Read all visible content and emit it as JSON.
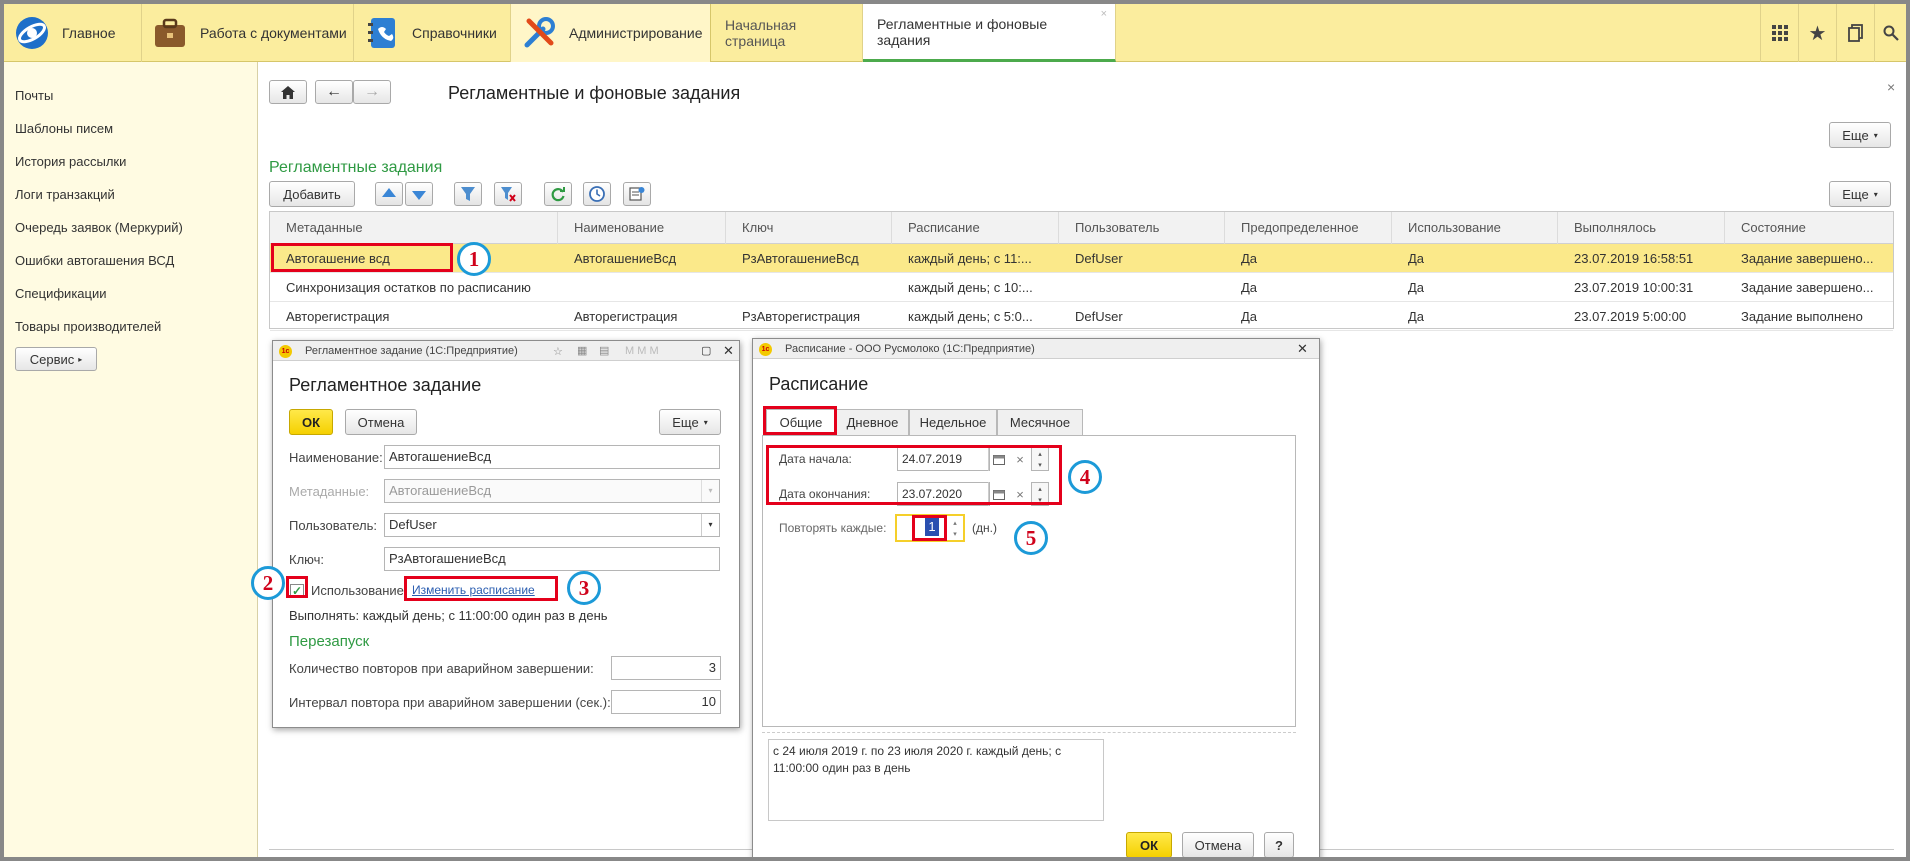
{
  "topbar": {
    "sections": [
      {
        "label": "Главное",
        "icon": "main-logo-icon"
      },
      {
        "label": "Работа с документами",
        "icon": "briefcase-icon"
      },
      {
        "label": "Справочники",
        "icon": "address-book-icon"
      },
      {
        "label": "Администрирование",
        "icon": "tools-icon"
      }
    ],
    "open_tabs": [
      "Начальная страница",
      "Регламентные и фоновые задания"
    ],
    "right_icons": [
      "apps-grid-icon",
      "star-icon",
      "history-icon",
      "search-icon"
    ]
  },
  "sidebar": {
    "items": [
      "Почты",
      "Шаблоны писем",
      "История рассылки",
      "Логи транзакций",
      "Очередь заявок (Меркурий)",
      "Ошибки автогашения ВСД",
      "Спецификации",
      "Товары производителей"
    ],
    "service_button": "Сервис"
  },
  "page": {
    "title": "Регламентные и фоновые задания",
    "more_label": "Еще",
    "section_title": "Регламентные задания",
    "add_label": "Добавить",
    "more_label2": "Еще"
  },
  "grid": {
    "columns": [
      "Метаданные",
      "Наименование",
      "Ключ",
      "Расписание",
      "Пользователь",
      "Предопределенное",
      "Использование",
      "Выполнялось",
      "Состояние"
    ],
    "rows": [
      [
        "Автогашение всд",
        "АвтогашениеВсд",
        "РзАвтогашениеВсд",
        "каждый  день; с 11:...",
        "DefUser",
        "Да",
        "Да",
        "23.07.2019 16:58:51",
        "Задание завершено..."
      ],
      [
        "Синхронизация остатков по расписанию",
        "",
        "",
        "каждый  день; с 10:...",
        "",
        "Да",
        "Да",
        "23.07.2019 10:00:31",
        "Задание завершено..."
      ],
      [
        "Авторегистрация",
        "Авторегистрация",
        "РзАвторегистрация",
        "каждый  день; с 5:0...",
        "DefUser",
        "Да",
        "Да",
        "23.07.2019 5:00:00",
        "Задание выполнено"
      ]
    ]
  },
  "job_window": {
    "title": "Регламентное задание  (1С:Предприятие)",
    "heading": "Регламентное задание",
    "ok": "ОК",
    "cancel": "Отмена",
    "more": "Еще",
    "name_label": "Наименование:",
    "name_value": "АвтогашениеВсд",
    "meta_label": "Метаданные:",
    "meta_value": "АвтогашениеВсд",
    "user_label": "Пользователь:",
    "user_value": "DefUser",
    "key_label": "Ключ:",
    "key_value": "РзАвтогашениеВсд",
    "use_label": "Использование",
    "change_link": "Изменить расписание",
    "run_text": "Выполнять: каждый  день; с 11:00:00 один раз в день",
    "restart_title": "Перезапуск",
    "retries_label": "Количество повторов при аварийном завершении:",
    "retries_value": "3",
    "interval_label": "Интервал повтора при аварийном завершении (сек.):",
    "interval_value": "10"
  },
  "schedule_window": {
    "title": "Расписание - ООО Русмолоко  (1С:Предприятие)",
    "heading": "Расписание",
    "tabs": [
      "Общие",
      "Дневное",
      "Недельное",
      "Месячное"
    ],
    "start_label": "Дата начала:",
    "start_value": "24.07.2019",
    "end_label": "Дата окончания:",
    "end_value": "23.07.2020",
    "repeat_label": "Повторять каждые:",
    "repeat_value": "1",
    "repeat_unit": "(дн.)",
    "summary": "с 24 июля 2019 г. по 23 июля 2020 г. каждый  день; с 11:00:00 один раз в день",
    "ok": "ОК",
    "cancel": "Отмена",
    "help": "?"
  },
  "annotations": [
    "1",
    "2",
    "3",
    "4",
    "5"
  ],
  "colors": {
    "accent_yellow": "#fbed9e",
    "green": "#2f9a43",
    "highlight": "#e4001b",
    "circle": "#1c9ad8"
  }
}
